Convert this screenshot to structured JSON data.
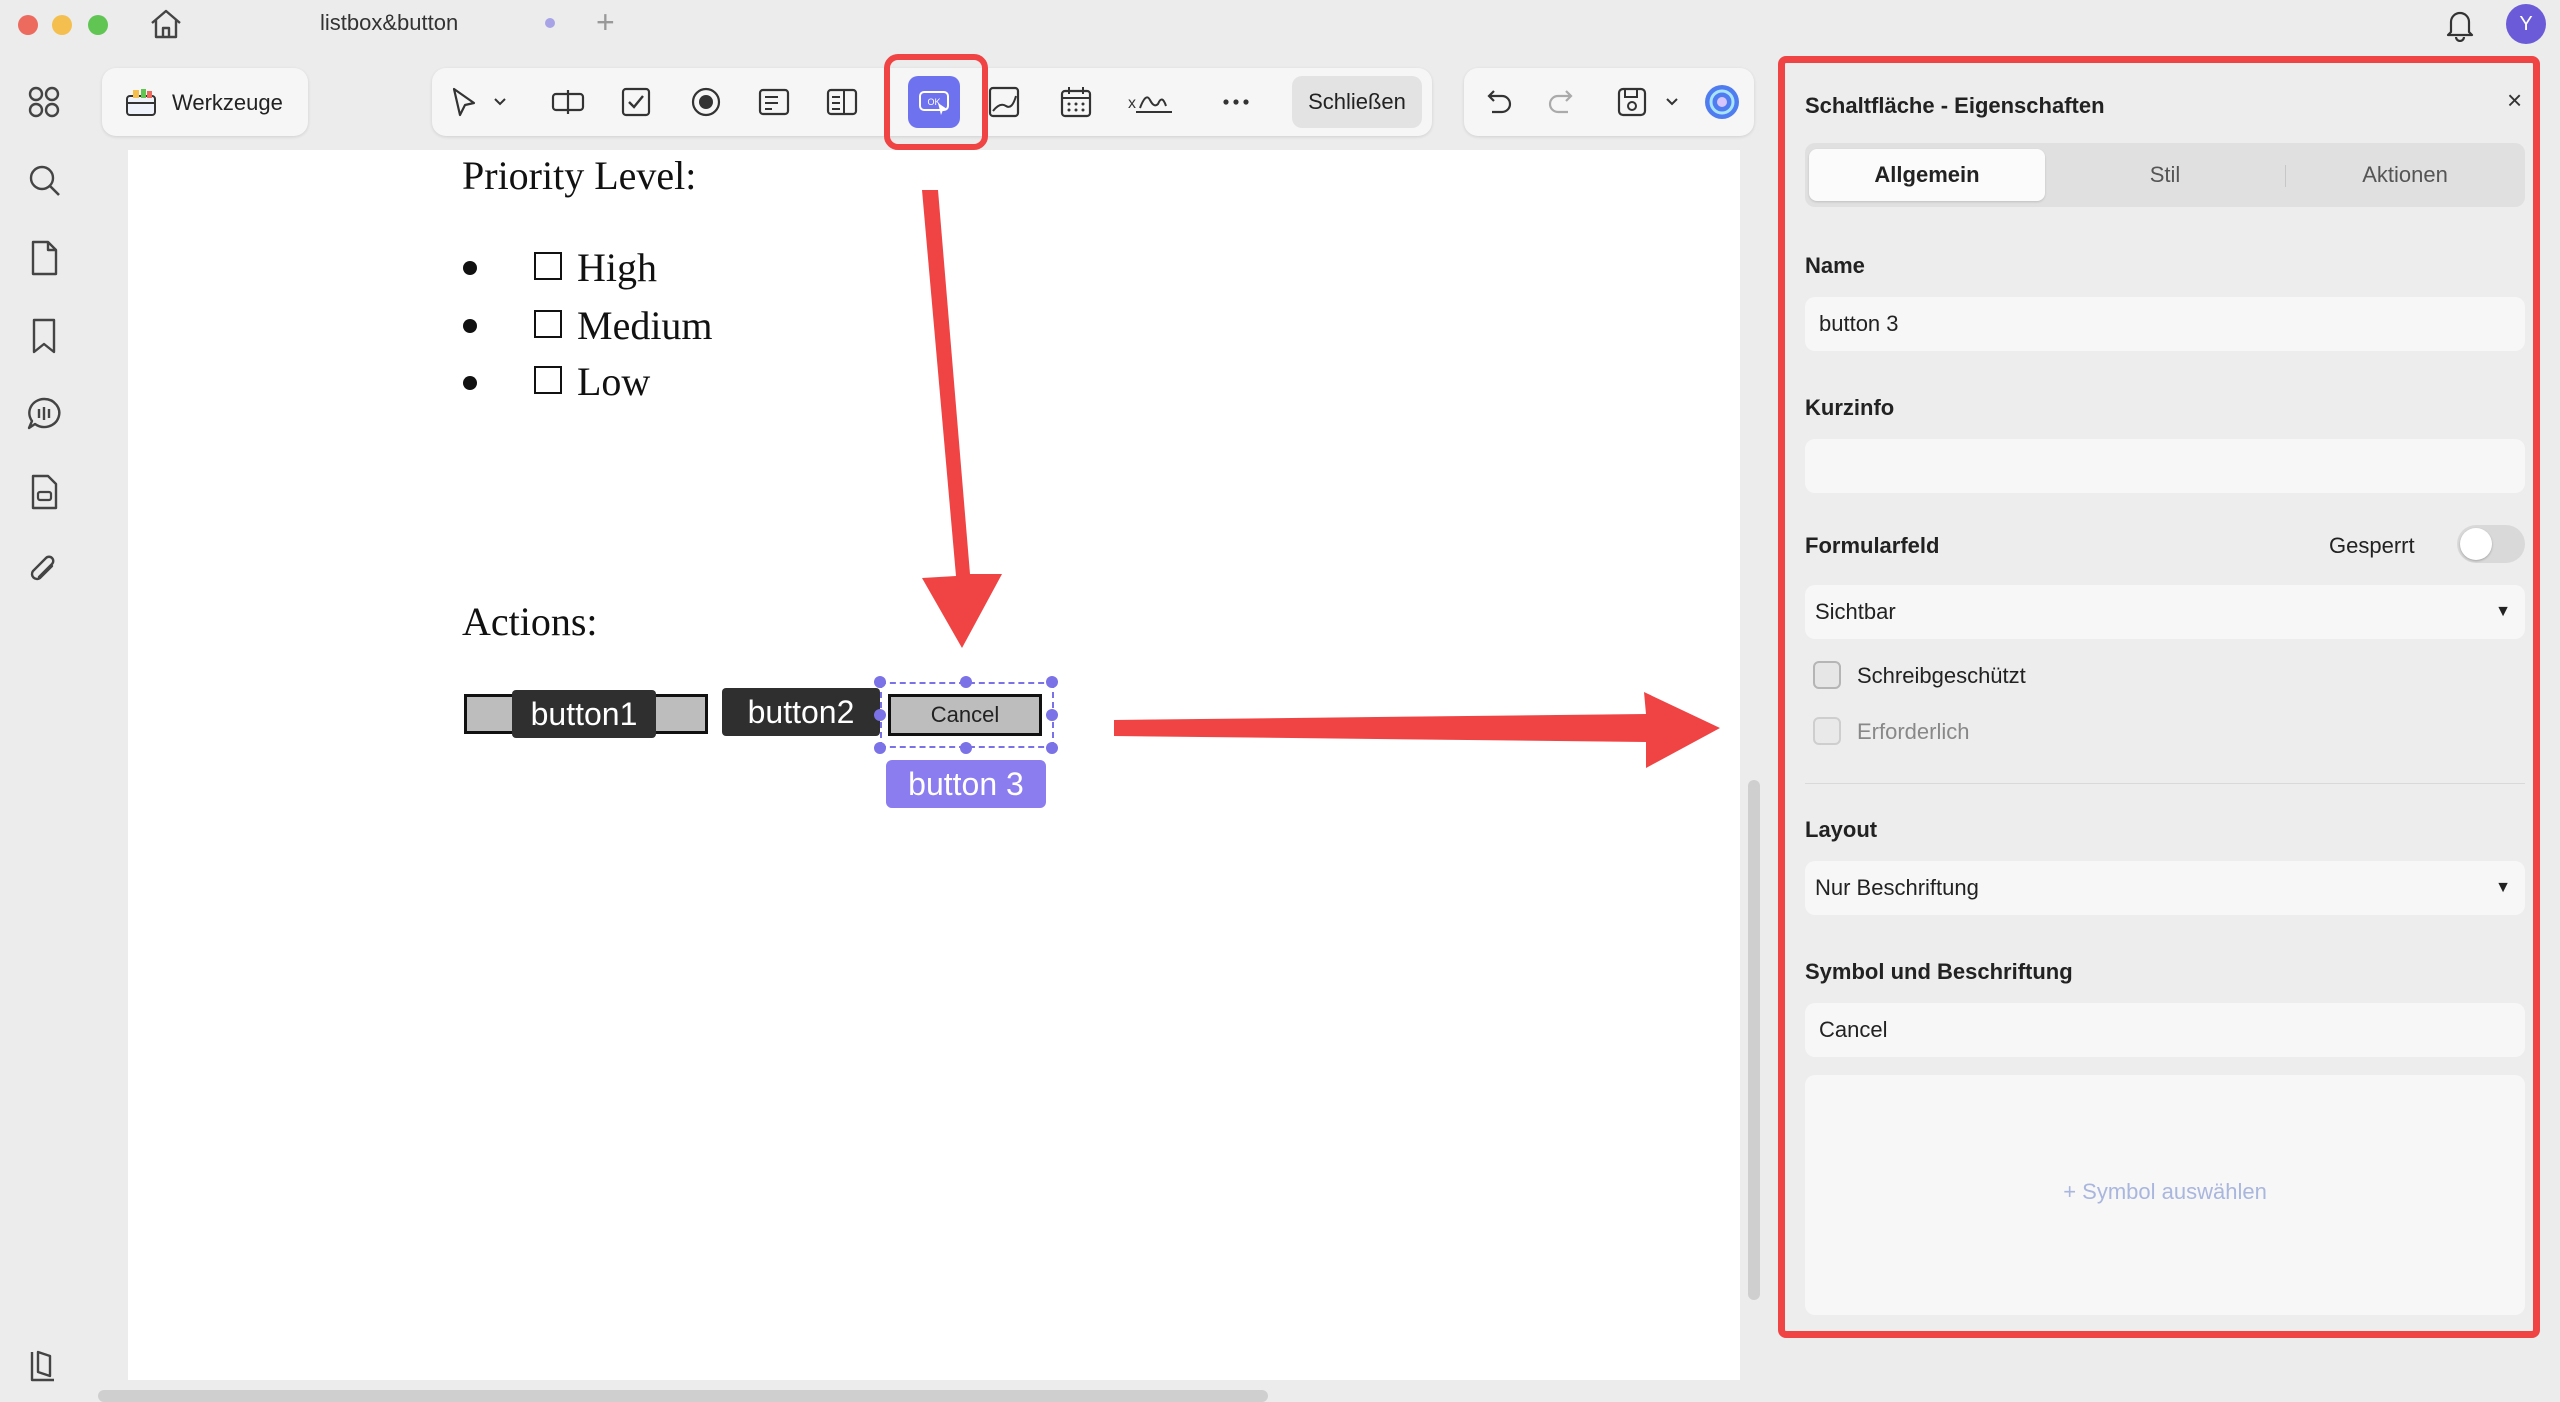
{
  "window": {
    "tab_title": "listbox&button",
    "avatar_initial": "Y"
  },
  "toolbar": {
    "tools_label": "Werkzeuge",
    "close_label": "Schließen",
    "icons": [
      "cursor-icon",
      "text-field-icon",
      "checkbox-icon",
      "radio-icon",
      "combobox-icon",
      "listbox-icon",
      "button-icon",
      "image-icon",
      "date-icon",
      "signature-icon",
      "more-icon",
      "undo-icon",
      "redo-icon",
      "save-icon",
      "ai-assistant-icon"
    ]
  },
  "document": {
    "priority_heading": "Priority Level:",
    "priority_items": [
      "High",
      "Medium",
      "Low"
    ],
    "actions_heading": "Actions:",
    "button1_label": "button1",
    "button2_label": "button2",
    "button3_caption": "Cancel",
    "selection_tag": "button 3"
  },
  "panel": {
    "title": "Schaltfläche - Eigenschaften",
    "tabs": [
      "Allgemein",
      "Stil",
      "Aktionen"
    ],
    "active_tab": "Allgemein",
    "name_label": "Name",
    "name_value": "button 3",
    "tooltip_label": "Kurzinfo",
    "tooltip_value": "",
    "form_field_label": "Formularfeld",
    "locked_label": "Gesperrt",
    "locked": false,
    "visibility_value": "Sichtbar",
    "readonly_label": "Schreibgeschützt",
    "readonly_checked": false,
    "required_label": "Erforderlich",
    "required_checked": false,
    "layout_label": "Layout",
    "layout_value": "Nur Beschriftung",
    "icon_caption_label": "Symbol und Beschriftung",
    "caption_value": "Cancel",
    "pick_icon_label": "+ Symbol auswählen"
  },
  "colors": {
    "accent": "#6f72ef",
    "highlight": "#f04444",
    "selection": "#8b7cf0"
  }
}
